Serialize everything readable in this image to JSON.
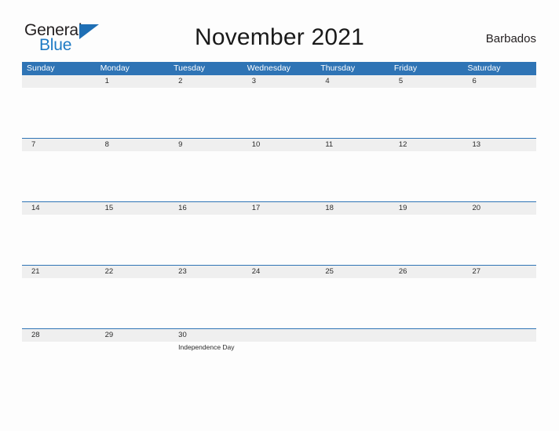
{
  "logo": {
    "word_one": "General",
    "word_two": "Blue",
    "triangle_color": "#1f6fb5",
    "blue_text_color": "#1d7ac4",
    "icon": "general-blue-flag-icon"
  },
  "header": {
    "title": "November 2021",
    "region": "Barbados"
  },
  "theme": {
    "header_blue": "#2f74b5",
    "date_band_gray": "#efefef",
    "page_background": "#fdfdfd",
    "text_color": "#2b2b2b"
  },
  "calendar": {
    "weekdays": [
      "Sunday",
      "Monday",
      "Tuesday",
      "Wednesday",
      "Thursday",
      "Friday",
      "Saturday"
    ],
    "weeks": [
      [
        {
          "date": "",
          "events": []
        },
        {
          "date": "1",
          "events": []
        },
        {
          "date": "2",
          "events": []
        },
        {
          "date": "3",
          "events": []
        },
        {
          "date": "4",
          "events": []
        },
        {
          "date": "5",
          "events": []
        },
        {
          "date": "6",
          "events": []
        }
      ],
      [
        {
          "date": "7",
          "events": []
        },
        {
          "date": "8",
          "events": []
        },
        {
          "date": "9",
          "events": []
        },
        {
          "date": "10",
          "events": []
        },
        {
          "date": "11",
          "events": []
        },
        {
          "date": "12",
          "events": []
        },
        {
          "date": "13",
          "events": []
        }
      ],
      [
        {
          "date": "14",
          "events": []
        },
        {
          "date": "15",
          "events": []
        },
        {
          "date": "16",
          "events": []
        },
        {
          "date": "17",
          "events": []
        },
        {
          "date": "18",
          "events": []
        },
        {
          "date": "19",
          "events": []
        },
        {
          "date": "20",
          "events": []
        }
      ],
      [
        {
          "date": "21",
          "events": []
        },
        {
          "date": "22",
          "events": []
        },
        {
          "date": "23",
          "events": []
        },
        {
          "date": "24",
          "events": []
        },
        {
          "date": "25",
          "events": []
        },
        {
          "date": "26",
          "events": []
        },
        {
          "date": "27",
          "events": []
        }
      ],
      [
        {
          "date": "28",
          "events": []
        },
        {
          "date": "29",
          "events": []
        },
        {
          "date": "30",
          "events": [
            "Independence Day"
          ]
        },
        {
          "date": "",
          "events": []
        },
        {
          "date": "",
          "events": []
        },
        {
          "date": "",
          "events": []
        },
        {
          "date": "",
          "events": []
        }
      ]
    ]
  }
}
